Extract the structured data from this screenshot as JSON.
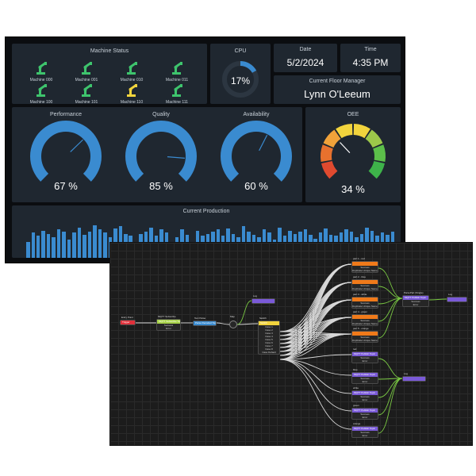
{
  "dashboard": {
    "machine_status": {
      "title": "Machine Status",
      "machines": [
        {
          "label": "Machine 000",
          "color": "#3ec46d"
        },
        {
          "label": "Machine 001",
          "color": "#3ec46d"
        },
        {
          "label": "Machine 010",
          "color": "#3ec46d"
        },
        {
          "label": "Machine 011",
          "color": "#3ec46d"
        },
        {
          "label": "Machine 100",
          "color": "#3ec46d"
        },
        {
          "label": "Machine 101",
          "color": "#3ec46d"
        },
        {
          "label": "Machine 110",
          "color": "#f2d43d"
        },
        {
          "label": "Machine 111",
          "color": "#3ec46d"
        }
      ]
    },
    "cpu": {
      "title": "CPU",
      "value_text": "17%",
      "value": 17
    },
    "date": {
      "title": "Date",
      "value": "5/2/2024"
    },
    "time": {
      "title": "Time",
      "value": "4:35 PM"
    },
    "floor_manager": {
      "title": "Current Floor Manager",
      "value": "Lynn O'Leeum"
    },
    "gauges": [
      {
        "title": "Performance",
        "value_text": "67 %",
        "value": 67
      },
      {
        "title": "Quality",
        "value_text": "85 %",
        "value": 85
      },
      {
        "title": "Availability",
        "value_text": "60 %",
        "value": 60
      }
    ],
    "oee": {
      "title": "OEE",
      "value_text": "34 %",
      "value": 34
    },
    "current_production": {
      "title": "Current Production",
      "values": [
        35,
        55,
        48,
        60,
        52,
        45,
        62,
        58,
        40,
        55,
        66,
        50,
        58,
        72,
        62,
        56,
        45,
        64,
        70,
        52,
        48,
        28,
        52,
        58,
        66,
        48,
        62,
        55,
        30,
        45,
        62,
        50,
        35,
        60,
        48,
        52,
        58,
        62,
        48,
        64,
        52,
        45,
        70,
        58,
        50,
        45,
        62,
        55,
        40,
        66,
        48,
        60,
        52,
        58,
        62,
        50,
        42,
        56,
        64,
        50,
        48,
        55,
        62,
        58,
        45,
        52,
        66,
        60,
        48,
        55,
        50,
        58
      ]
    },
    "colors": {
      "accent": "#3a8bd0",
      "panel": "#1f2730",
      "bg": "#0b0d10"
    }
  },
  "flow": {
    "nodes": {
      "entry": {
        "title": "Entry Point",
        "label": "Trigger"
      },
      "subscribe": {
        "title": "MQTT Subscribe",
        "label": "MQTT Subscribe Topic",
        "rows": [
          "Success",
          "Error"
        ]
      },
      "parse": {
        "title": "Text Parse",
        "label": "Parse Decoded Topic"
      },
      "map": {
        "title": "Map"
      },
      "log_top": {
        "title": "Log"
      },
      "switch": {
        "title": "Switch",
        "label": "Switch",
        "rows": [
          "Case 1",
          "Case 2",
          "Case 3",
          "Case 4",
          "Case 5",
          "Case 6",
          "Case 7",
          "Case 8",
          "Case Default"
        ]
      },
      "parsepart": {
        "title": "ParsePart (Single)",
        "label": "MQTT Publish Topic",
        "rows": [
          "Success",
          "Error"
        ]
      },
      "log_right": {
        "title": "Log"
      },
      "log_mid": {
        "title": "Log"
      },
      "orange": [
        {
          "title": "part 1 - red",
          "rows": [
            "Success",
            "Duplicate Unique Name"
          ]
        },
        {
          "title": "part 2 - blue",
          "rows": [
            "Success",
            "Duplicate Unique Name"
          ]
        },
        {
          "title": "part 3 - white",
          "rows": [
            "Success",
            "Duplicate Unique Name"
          ]
        },
        {
          "title": "part 4 - green",
          "rows": [
            "Success",
            "Duplicate Unique Name"
          ]
        },
        {
          "title": "part 5 - orange",
          "rows": [
            "Success",
            "Duplicate Unique Name"
          ]
        }
      ],
      "purple": [
        {
          "title": "red",
          "label": "MQTT Publish Topic",
          "rows": [
            "Success",
            "Error"
          ]
        },
        {
          "title": "blue",
          "label": "MQTT Publish Topic",
          "rows": [
            "Success",
            "Error"
          ]
        },
        {
          "title": "white",
          "label": "MQTT Publish Topic",
          "rows": [
            "Success",
            "Error"
          ]
        },
        {
          "title": "green",
          "label": "MQTT Publish Topic",
          "rows": [
            "Success",
            "Error"
          ]
        },
        {
          "title": "orange",
          "label": "MQTT Publish Topic",
          "rows": [
            "Success",
            "Error"
          ]
        }
      ]
    },
    "colors": {
      "trigger": "#e0303a",
      "subscribe": "#a8d24a",
      "parse": "#3a8bd0",
      "switch": "#f2d43d",
      "orange": "#f07a1a",
      "purple": "#7a5ad8",
      "wire": "#d8d8d8",
      "wire_green": "#7ac943"
    }
  }
}
